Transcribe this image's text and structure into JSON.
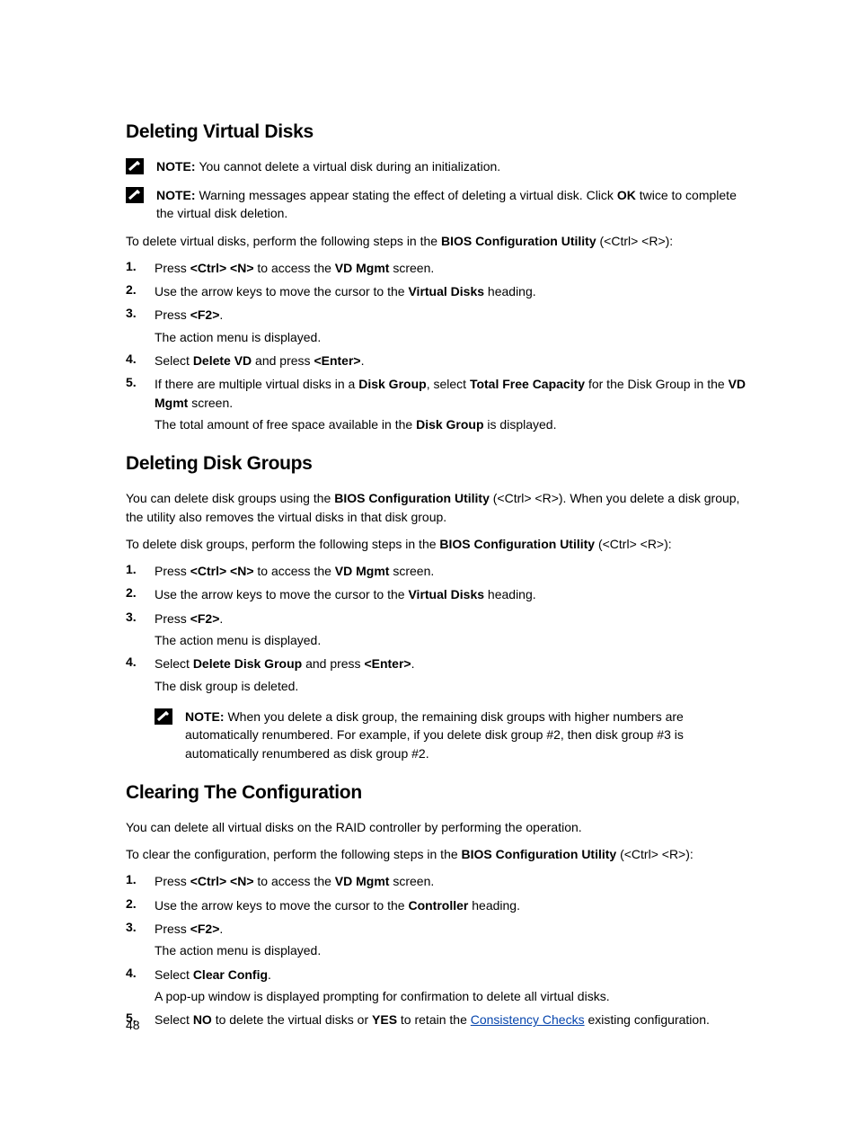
{
  "sections": [
    {
      "heading": "Deleting Virtual Disks",
      "notes": [
        {
          "segments": [
            {
              "t": "NOTE: ",
              "b": true
            },
            {
              "t": "You cannot delete a virtual disk during an initialization."
            }
          ]
        },
        {
          "segments": [
            {
              "t": "NOTE: ",
              "b": true
            },
            {
              "t": "Warning messages appear stating the effect of deleting a virtual disk. Click "
            },
            {
              "t": "OK",
              "b": true
            },
            {
              "t": " twice to complete the virtual disk deletion."
            }
          ]
        }
      ],
      "intro": {
        "segments": [
          {
            "t": "To delete virtual disks, perform the following steps in the "
          },
          {
            "t": "BIOS Configuration Utility",
            "b": true
          },
          {
            "t": " (<Ctrl> <R>):"
          }
        ]
      },
      "steps": [
        {
          "num": "1.",
          "segments": [
            {
              "t": "Press "
            },
            {
              "t": "<Ctrl> <N>",
              "b": true
            },
            {
              "t": " to access the "
            },
            {
              "t": "VD Mgmt",
              "b": true
            },
            {
              "t": " screen."
            }
          ]
        },
        {
          "num": "2.",
          "segments": [
            {
              "t": "Use the arrow keys to move the cursor to the "
            },
            {
              "t": "Virtual Disks",
              "b": true
            },
            {
              "t": " heading."
            }
          ]
        },
        {
          "num": "3.",
          "segments": [
            {
              "t": "Press "
            },
            {
              "t": "<F2>",
              "b": true
            },
            {
              "t": "."
            }
          ],
          "sub": "The action menu is displayed."
        },
        {
          "num": "4.",
          "segments": [
            {
              "t": "Select "
            },
            {
              "t": "Delete VD",
              "b": true
            },
            {
              "t": " and press "
            },
            {
              "t": "<Enter>",
              "b": true
            },
            {
              "t": "."
            }
          ]
        },
        {
          "num": "5.",
          "segments": [
            {
              "t": "If there are multiple virtual disks in a "
            },
            {
              "t": "Disk Group",
              "b": true
            },
            {
              "t": ", select "
            },
            {
              "t": "Total Free Capacity",
              "b": true
            },
            {
              "t": " for the Disk Group in the "
            },
            {
              "t": "VD Mgmt",
              "b": true
            },
            {
              "t": " screen."
            }
          ],
          "sub_segments": [
            {
              "t": "The total amount of free space available in the "
            },
            {
              "t": "Disk Group",
              "b": true
            },
            {
              "t": " is displayed."
            }
          ]
        }
      ]
    },
    {
      "heading": "Deleting Disk Groups",
      "pre_intro": {
        "segments": [
          {
            "t": "You can delete disk groups using the "
          },
          {
            "t": "BIOS Configuration Utility",
            "b": true
          },
          {
            "t": " (<Ctrl> <R>). When you delete a disk group, the utility also removes the virtual disks in that disk group."
          }
        ]
      },
      "intro": {
        "segments": [
          {
            "t": "To delete disk groups, perform the following steps in the "
          },
          {
            "t": "BIOS Configuration Utility",
            "b": true
          },
          {
            "t": " (<Ctrl> <R>):"
          }
        ]
      },
      "steps": [
        {
          "num": "1.",
          "segments": [
            {
              "t": "Press "
            },
            {
              "t": "<Ctrl> <N>",
              "b": true
            },
            {
              "t": " to access the "
            },
            {
              "t": "VD Mgmt",
              "b": true
            },
            {
              "t": " screen."
            }
          ]
        },
        {
          "num": "2.",
          "segments": [
            {
              "t": "Use the arrow keys to move the cursor to the "
            },
            {
              "t": "Virtual Disks",
              "b": true
            },
            {
              "t": " heading."
            }
          ]
        },
        {
          "num": "3.",
          "segments": [
            {
              "t": "Press "
            },
            {
              "t": "<F2>",
              "b": true
            },
            {
              "t": "."
            }
          ],
          "sub": "The action menu is displayed."
        },
        {
          "num": "4.",
          "segments": [
            {
              "t": "Select "
            },
            {
              "t": "Delete Disk Group",
              "b": true
            },
            {
              "t": " and press "
            },
            {
              "t": "<Enter>",
              "b": true
            },
            {
              "t": "."
            }
          ],
          "sub": "The disk group is deleted."
        }
      ],
      "notes_after": [
        {
          "segments": [
            {
              "t": "NOTE: ",
              "b": true
            },
            {
              "t": "When you delete a disk group, the remaining disk groups with higher numbers are automatically renumbered. For example, if you delete disk group #2, then disk group #3 is automatically renumbered as disk group #2."
            }
          ]
        }
      ]
    },
    {
      "heading": "Clearing The Configuration",
      "pre_intro": {
        "segments": [
          {
            "t": "You can delete all virtual disks on the RAID controller by performing the operation."
          }
        ]
      },
      "intro": {
        "segments": [
          {
            "t": "To clear the configuration, perform the following steps in the "
          },
          {
            "t": "BIOS Configuration Utility",
            "b": true
          },
          {
            "t": " (<Ctrl> <R>):"
          }
        ]
      },
      "steps": [
        {
          "num": "1.",
          "segments": [
            {
              "t": "Press "
            },
            {
              "t": "<Ctrl> <N>",
              "b": true
            },
            {
              "t": " to access the "
            },
            {
              "t": "VD Mgmt",
              "b": true
            },
            {
              "t": " screen."
            }
          ]
        },
        {
          "num": "2.",
          "segments": [
            {
              "t": "Use the arrow keys to move the cursor to the "
            },
            {
              "t": "Controller",
              "b": true
            },
            {
              "t": " heading."
            }
          ]
        },
        {
          "num": "3.",
          "segments": [
            {
              "t": "Press "
            },
            {
              "t": "<F2>",
              "b": true
            },
            {
              "t": "."
            }
          ],
          "sub": "The action menu is displayed."
        },
        {
          "num": "4.",
          "segments": [
            {
              "t": "Select "
            },
            {
              "t": "Clear Config",
              "b": true
            },
            {
              "t": "."
            }
          ],
          "sub": "A pop-up window is displayed prompting for confirmation to delete all virtual disks."
        },
        {
          "num": "5.",
          "segments": [
            {
              "t": "Select "
            },
            {
              "t": "NO",
              "b": true
            },
            {
              "t": " to delete the virtual disks or "
            },
            {
              "t": "YES",
              "b": true
            },
            {
              "t": " to retain the "
            },
            {
              "t": "Consistency Checks",
              "link": true
            },
            {
              "t": " existing configuration."
            }
          ]
        }
      ]
    }
  ],
  "page_number": "48"
}
